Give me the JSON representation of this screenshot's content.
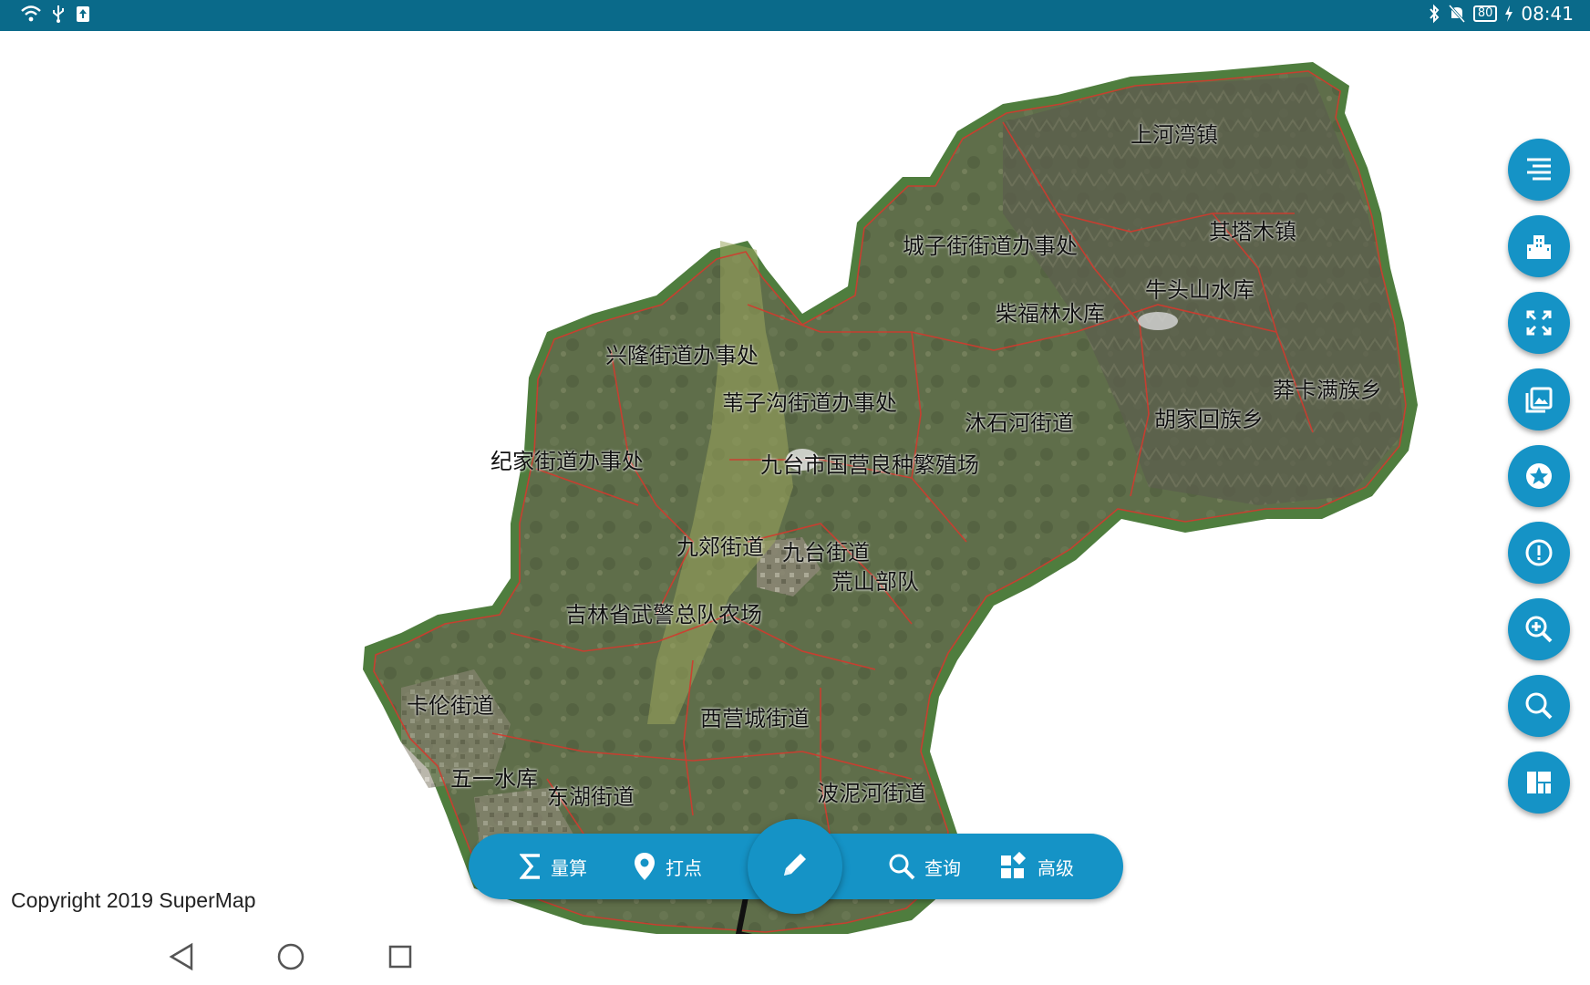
{
  "status_bar": {
    "time": "08:41",
    "battery": "80",
    "left_icons": [
      "wifi-icon",
      "usb-icon",
      "upload-icon"
    ],
    "right_icons": [
      "bluetooth-icon",
      "mute-icon",
      "battery-icon",
      "charging-icon"
    ]
  },
  "map": {
    "labels": {
      "shanghewan": "上河湾镇",
      "chengzijie": "城子街街道办事处",
      "qitamu": "其塔木镇",
      "niutoushan": "牛头山水库",
      "chaifulin": "柴福林水库",
      "xinglong": "兴隆街道办事处",
      "weizigou": "苇子沟街道办事处",
      "mushihe": "沐石河街道",
      "hujiahui": "胡家回族乡",
      "mangkaman": "莽卡满族乡",
      "jijia": "纪家街道办事处",
      "jiutaifarm": "九台市国营良种繁殖场",
      "jiujiao": "九郊街道",
      "jiutai": "九台街道",
      "huangshan": "荒山部队",
      "wujing": "吉林省武警总队农场",
      "kalun": "卡伦街道",
      "xiyingcheng": "西营城街道",
      "wuyi": "五一水库",
      "donghu": "东湖街道",
      "bonihe": "波泥河街道"
    },
    "copyright": "Copyright 2019 SuperMap"
  },
  "side_buttons": [
    "list-icon",
    "building-icon",
    "fullscreen-icon",
    "gallery-icon",
    "star-icon",
    "alert-icon",
    "zoom-in-icon",
    "search-icon",
    "dashboard-icon"
  ],
  "toolbar": {
    "measure_label": "量算",
    "mark_label": "打点",
    "query_label": "查询",
    "advanced_label": "高级"
  },
  "colors": {
    "accent": "#1593c6",
    "status_bar": "#0a6a8a",
    "boundary": "#d23a2e",
    "terrain": "#5f6e4a"
  }
}
